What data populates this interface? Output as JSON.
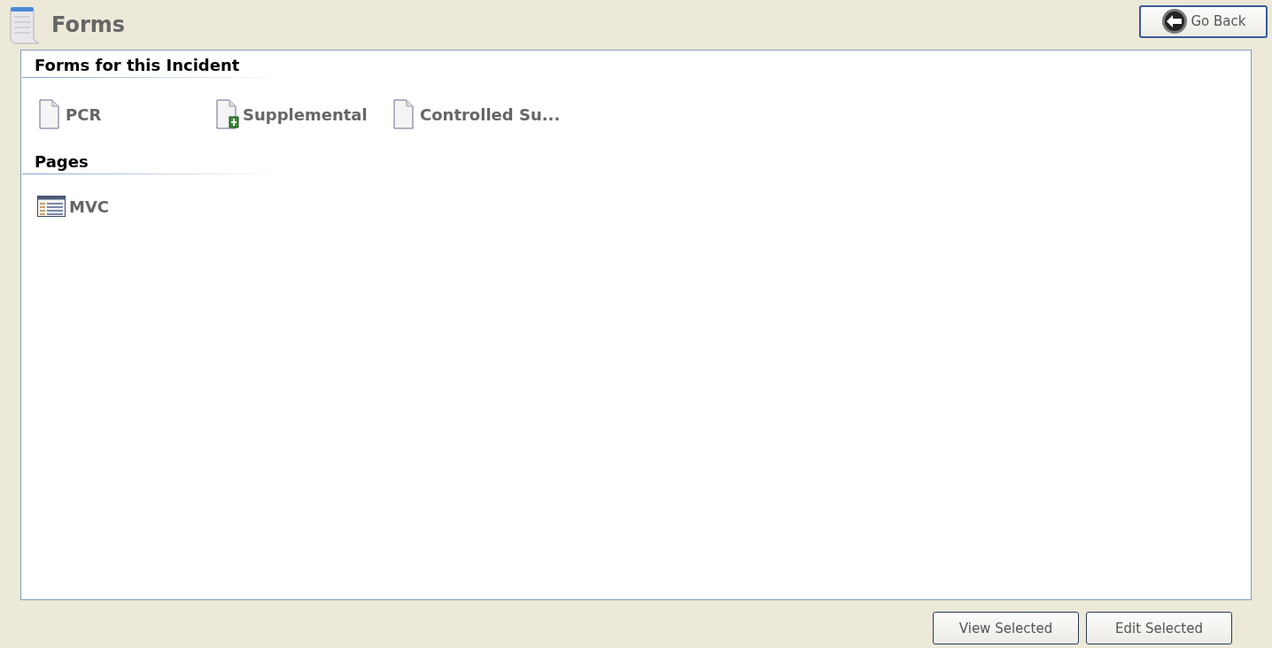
{
  "header": {
    "title": "Forms",
    "back_button": "Go Back"
  },
  "sections": [
    {
      "heading": "Forms for this Incident",
      "items": [
        {
          "label": "PCR",
          "kind": "form"
        },
        {
          "label": "Supplemental",
          "kind": "form-plus"
        },
        {
          "label": "Controlled Su...",
          "kind": "form"
        }
      ]
    },
    {
      "heading": "Pages",
      "items": [
        {
          "label": "MVC",
          "kind": "page"
        }
      ]
    }
  ],
  "buttons": [
    "View Selected",
    "Edit Selected"
  ]
}
